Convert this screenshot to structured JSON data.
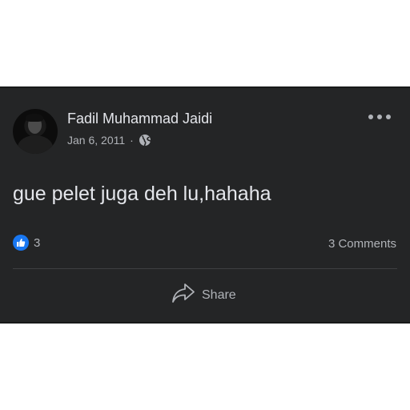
{
  "post": {
    "author_name": "Fadil Muhammad Jaidi",
    "date": "Jan 6, 2011",
    "separator": "·",
    "privacy_icon": "globe-icon",
    "text": "gue pelet juga deh lu,hahaha",
    "reaction_count": "3",
    "reaction_icon": "like-icon",
    "comments_label": "3 Comments",
    "share_label": "Share"
  },
  "colors": {
    "card_background": "#242526",
    "primary_text": "#e4e6eb",
    "secondary_text": "#b0b3b8",
    "like_blue": "#1877f2",
    "divider": "#3e4042"
  }
}
